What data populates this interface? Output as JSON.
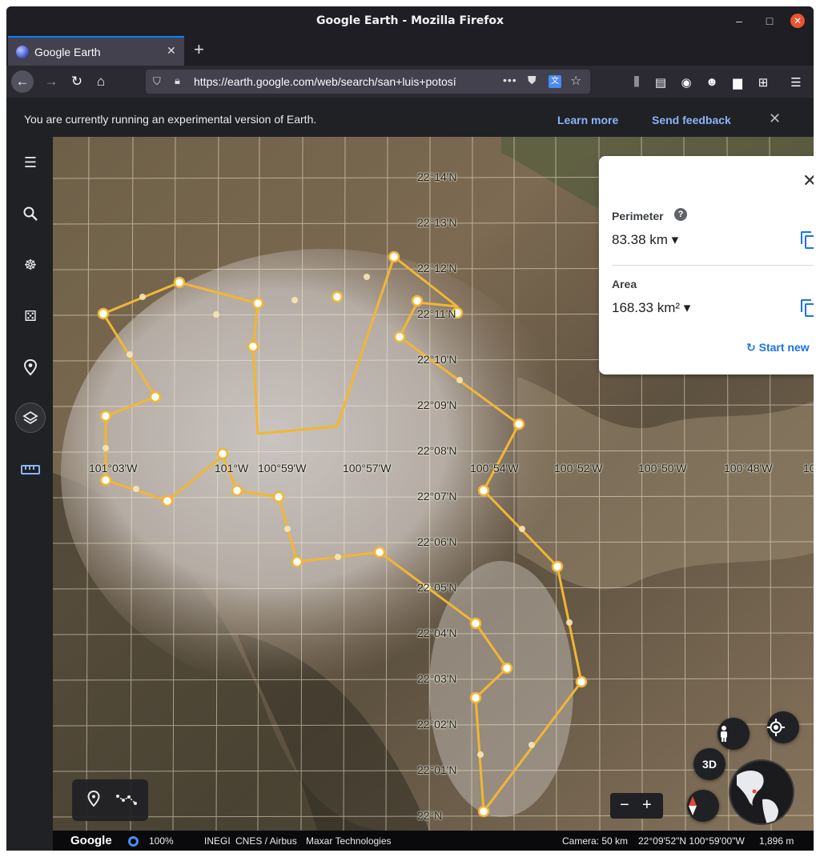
{
  "window": {
    "title": "Google Earth - Mozilla Firefox",
    "min_glyph": "–",
    "max_glyph": "□",
    "close_glyph": "✕"
  },
  "tab": {
    "title": "Google Earth",
    "close_glyph": "✕",
    "newtab_glyph": "+"
  },
  "nav": {
    "url": "https://earth.google.com/web/search/san+luis+potosí",
    "more_glyph": "•••",
    "back_glyph": "←",
    "forward_glyph": "→",
    "reload_glyph": "↻",
    "home_glyph": "⌂"
  },
  "infobar": {
    "message": "You are currently running an experimental version of Earth.",
    "learn_more": "Learn more",
    "send_feedback": "Send feedback",
    "close_glyph": "✕"
  },
  "sidebar": {
    "icons": [
      "menu-icon",
      "search-icon",
      "voyager-icon",
      "feeling-lucky-icon",
      "projects-icon",
      "map-style-icon",
      "measure-icon"
    ]
  },
  "map": {
    "lat_labels": [
      "22°14'N",
      "22°13'N",
      "22°12'N",
      "22°11'N",
      "22°10'N",
      "22°09'N",
      "22°08'N",
      "22°07'N",
      "22°06'N",
      "22°05'N",
      "22°04'N",
      "22°03'N",
      "22°02'N",
      "22°01'N",
      "22°N"
    ],
    "lon_labels": [
      "101°03'W",
      "101°W",
      "100°59'W",
      "100°57'W",
      "100°54'W",
      "100°52'W",
      "100°50'W",
      "100°48'W",
      "10"
    ],
    "polygon_color": "#f2b634"
  },
  "measure_panel": {
    "perimeter_label": "Perimeter",
    "perimeter_value": "83.38 km",
    "area_label": "Area",
    "area_value": "168.33 km²",
    "start_new": "Start new",
    "help_glyph": "?",
    "dropdown_glyph": "▾",
    "close_glyph": "✕",
    "reset_glyph": "↻"
  },
  "controls": {
    "button_3d": "3D",
    "zoom_out": "−",
    "zoom_in": "+"
  },
  "status": {
    "logo": "Google",
    "load_percent": "100%",
    "attribution_1": "INEGI",
    "attribution_2": "CNES / Airbus",
    "attribution_3": "Maxar Technologies",
    "camera": "Camera: 50 km",
    "coordinates": "22°09'52\"N 100°59'00\"W",
    "elevation": "1,896 m"
  }
}
